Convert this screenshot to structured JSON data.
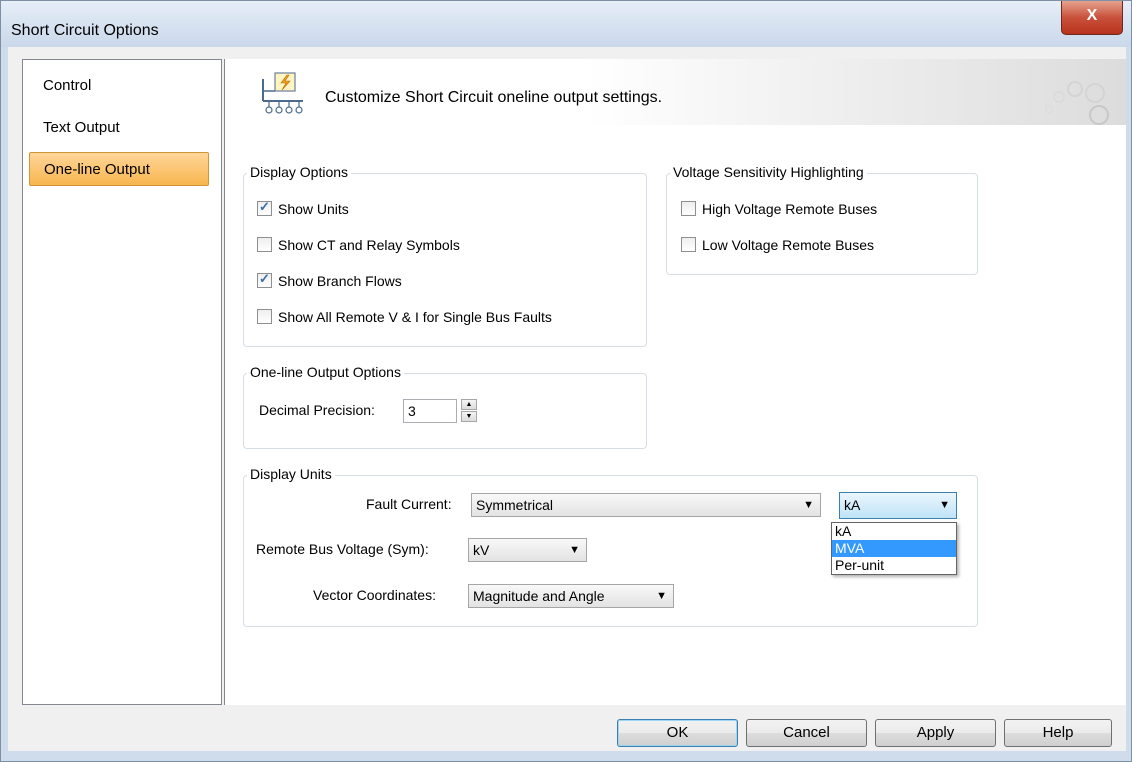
{
  "window": {
    "title": "Short Circuit Options",
    "close_label": "X"
  },
  "nav": {
    "items": [
      {
        "label": "Control",
        "active": false
      },
      {
        "label": "Text Output",
        "active": false
      },
      {
        "label": "One-line Output",
        "active": true
      }
    ]
  },
  "banner": {
    "text": "Customize Short Circuit oneline output settings."
  },
  "display_options": {
    "title": "Display Options",
    "items": [
      {
        "label": "Show Units",
        "checked": true
      },
      {
        "label": "Show CT and Relay Symbols",
        "checked": false
      },
      {
        "label": "Show Branch Flows",
        "checked": true
      },
      {
        "label": "Show All Remote V & I for Single Bus Faults",
        "checked": false
      }
    ]
  },
  "voltage_sensitivity": {
    "title": "Voltage Sensitivity Highlighting",
    "items": [
      {
        "label": "High Voltage Remote Buses",
        "checked": false
      },
      {
        "label": "Low Voltage Remote Buses",
        "checked": false
      }
    ]
  },
  "oneline_output_options": {
    "title": "One-line Output Options",
    "decimal_label": "Decimal Precision:",
    "decimal_value": "3"
  },
  "display_units": {
    "title": "Display Units",
    "fault_current_label": "Fault Current:",
    "fault_current_value": "Symmetrical",
    "fault_current_unit": "kA",
    "remote_bus_label": "Remote Bus Voltage (Sym):",
    "remote_bus_value": "kV",
    "vector_label": "Vector Coordinates:",
    "vector_value": "Magnitude and Angle"
  },
  "unit_dropdown": {
    "options": [
      "kA",
      "MVA",
      "Per-unit"
    ],
    "highlighted": "MVA"
  },
  "buttons": {
    "ok": "OK",
    "cancel": "Cancel",
    "apply": "Apply",
    "help": "Help"
  },
  "colors": {
    "active_nav": "#f8b54f",
    "highlight": "#3399ff",
    "close": "#c9513b"
  }
}
